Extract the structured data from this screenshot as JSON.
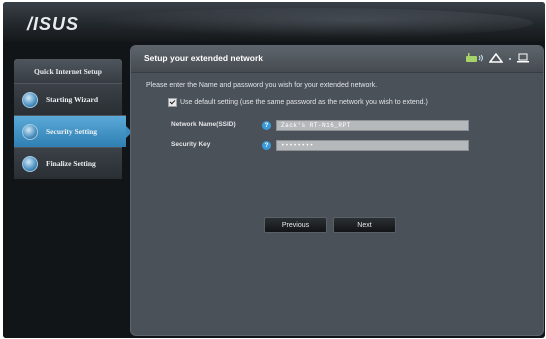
{
  "brand": {
    "logo_text": "/ISUS"
  },
  "sidebar": {
    "title": "Quick Internet Setup",
    "items": [
      {
        "label": "Starting Wizard",
        "active": false
      },
      {
        "label": "Security Setting",
        "active": true
      },
      {
        "label": "Finalize Setting",
        "active": false
      }
    ]
  },
  "main": {
    "title": "Setup your extended network",
    "instruction": "Please enter the Name and password you wish for your extended network.",
    "default_setting_label": "Use default setting (use the same password as the network you wish to extend.)",
    "default_setting_checked": true,
    "ssid": {
      "label": "Network Name(SSID)",
      "value": "Zack's RT-N16_RPT"
    },
    "security_key": {
      "label": "Security Key",
      "value": "••••••••"
    },
    "help_glyph": "?",
    "previous_label": "Previous",
    "next_label": "Next"
  },
  "colors": {
    "accent": "#3a8cc1",
    "panel": "#4b5158"
  }
}
